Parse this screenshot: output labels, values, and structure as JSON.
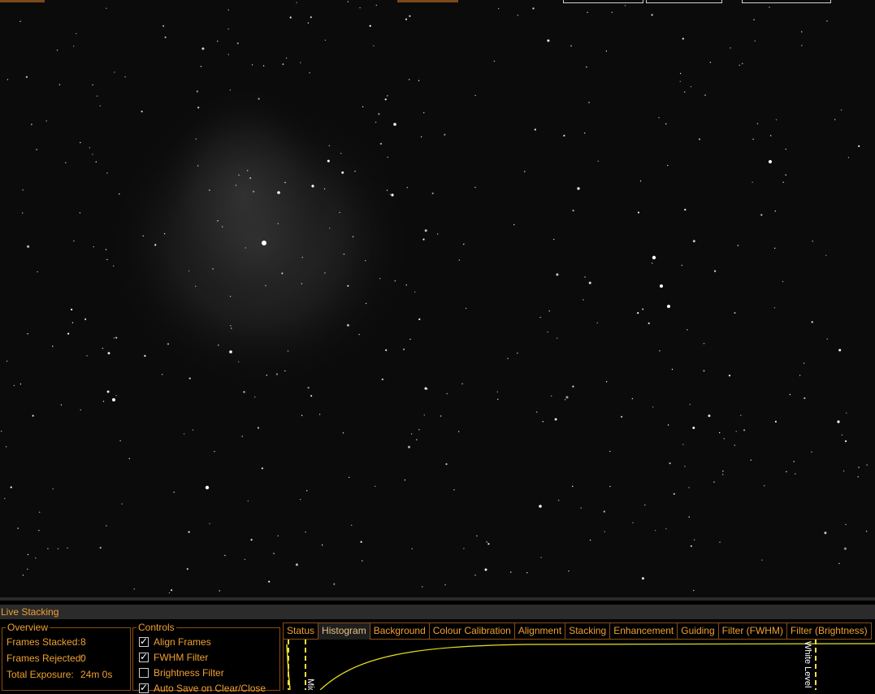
{
  "panel": {
    "title": "Live Stacking",
    "overview": {
      "legend": "Overview",
      "rows": [
        {
          "label": "Frames Stacked:",
          "value": "8"
        },
        {
          "label": "Frames Rejected:",
          "value": "0"
        },
        {
          "label": "Total Exposure:",
          "value": "24m 0s"
        }
      ]
    },
    "controls": {
      "legend": "Controls",
      "items": [
        {
          "label": "Align Frames",
          "checked": true
        },
        {
          "label": "FWHM Filter",
          "checked": true
        },
        {
          "label": "Brightness Filter",
          "checked": false
        },
        {
          "label": "Auto Save on Clear/Close",
          "checked": true
        }
      ]
    },
    "tabs": [
      "Status",
      "Histogram",
      "Background",
      "Colour Calibration",
      "Alignment",
      "Stacking",
      "Enhancement",
      "Guiding",
      "Filter (FWHM)",
      "Filter (Brightness)"
    ],
    "active_tab": "Histogram",
    "histogram": {
      "labels": {
        "mid": "Mid",
        "white": "White Level"
      },
      "colors": {
        "curve": "#e8e020",
        "marker": "#ffe040"
      }
    }
  },
  "colors": {
    "accent": "#f0a030",
    "border": "#8a4e10",
    "background": "#000000"
  }
}
